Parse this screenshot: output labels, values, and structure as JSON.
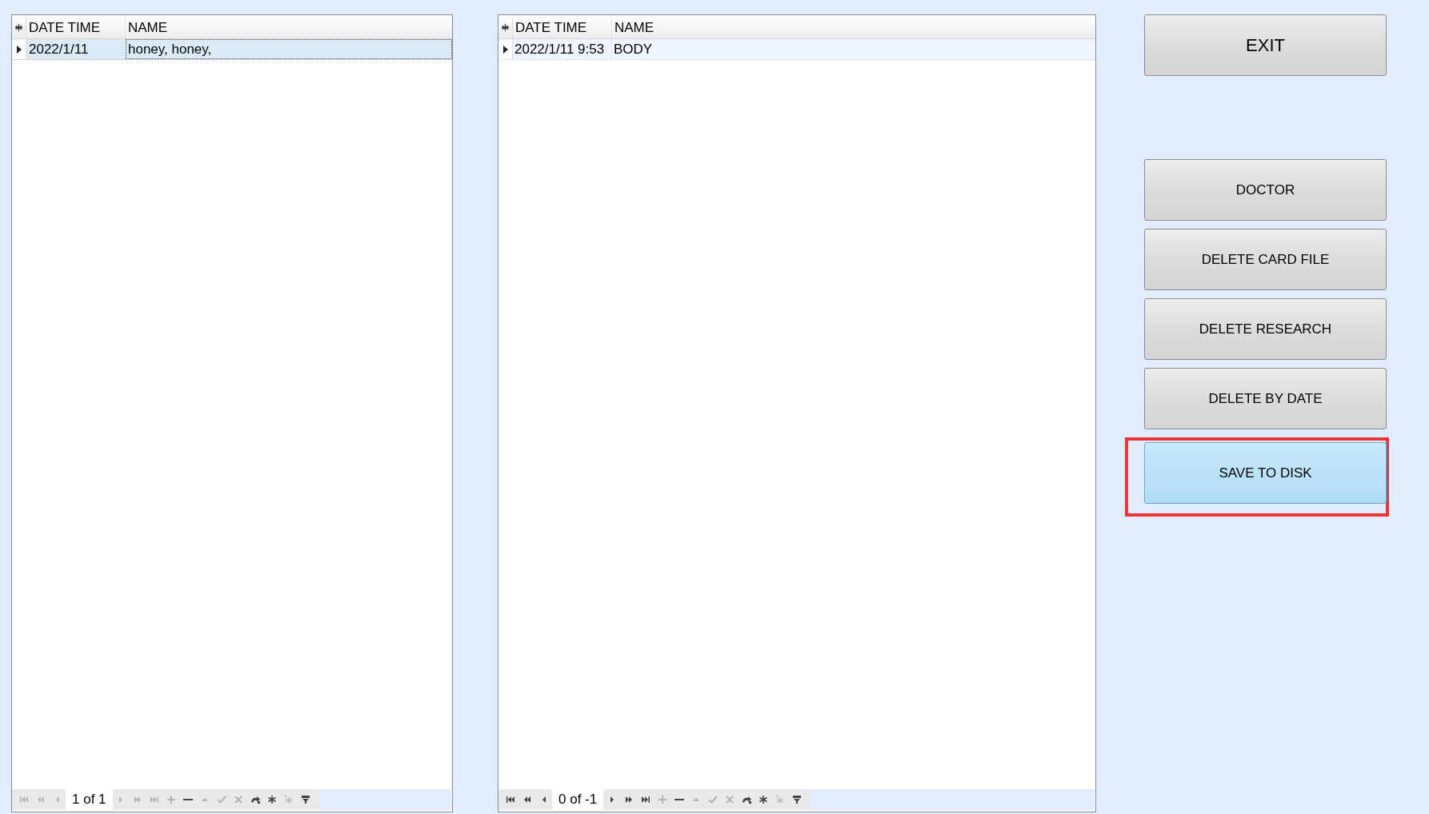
{
  "grids": [
    {
      "columns": [
        "DATE TIME",
        "NAME"
      ],
      "rows": [
        {
          "cells": [
            "2022/1/11",
            "honey, honey,"
          ],
          "selected": true
        }
      ],
      "navigator": {
        "position": "1 of 1",
        "buttons": [
          {
            "kind": "first",
            "disabled": true
          },
          {
            "kind": "prev_page",
            "disabled": true
          },
          {
            "kind": "prev",
            "disabled": true
          },
          {
            "kind": "next",
            "disabled": true
          },
          {
            "kind": "next_page",
            "disabled": true
          },
          {
            "kind": "last",
            "disabled": true
          },
          {
            "kind": "add",
            "disabled": true
          },
          {
            "kind": "remove",
            "disabled": false
          },
          {
            "kind": "up",
            "disabled": true
          },
          {
            "kind": "apply",
            "disabled": true
          },
          {
            "kind": "cancel",
            "disabled": true
          },
          {
            "kind": "refresh",
            "disabled": false
          },
          {
            "kind": "star",
            "disabled": false
          },
          {
            "kind": "clear",
            "disabled": true
          },
          {
            "kind": "filter",
            "disabled": false
          }
        ]
      }
    },
    {
      "columns": [
        "DATE TIME",
        "NAME"
      ],
      "rows": [
        {
          "cells": [
            "2022/1/11 9:53",
            "BODY"
          ],
          "selected": false
        }
      ],
      "navigator": {
        "position": "0 of -1",
        "buttons": [
          {
            "kind": "first",
            "disabled": false
          },
          {
            "kind": "prev_page",
            "disabled": false
          },
          {
            "kind": "prev",
            "disabled": false
          },
          {
            "kind": "next",
            "disabled": false
          },
          {
            "kind": "next_page",
            "disabled": false
          },
          {
            "kind": "last",
            "disabled": false
          },
          {
            "kind": "add",
            "disabled": true
          },
          {
            "kind": "remove",
            "disabled": false
          },
          {
            "kind": "up",
            "disabled": true
          },
          {
            "kind": "apply",
            "disabled": true
          },
          {
            "kind": "cancel",
            "disabled": true
          },
          {
            "kind": "refresh",
            "disabled": false
          },
          {
            "kind": "star",
            "disabled": false
          },
          {
            "kind": "clear",
            "disabled": true
          },
          {
            "kind": "filter",
            "disabled": false
          }
        ]
      }
    }
  ],
  "buttons": [
    {
      "label": "EXIT",
      "kind": "large",
      "hovered": false,
      "highlighted": false
    },
    {
      "label": "DOCTOR",
      "kind": "normal",
      "hovered": false,
      "highlighted": false
    },
    {
      "label": "DELETE CARD FILE",
      "kind": "normal",
      "hovered": false,
      "highlighted": false
    },
    {
      "label": "DELETE RESEARCH",
      "kind": "normal",
      "hovered": false,
      "highlighted": false
    },
    {
      "label": "DELETE BY DATE",
      "kind": "normal",
      "hovered": false,
      "highlighted": false
    },
    {
      "label": "SAVE TO DISK",
      "kind": "normal",
      "hovered": true,
      "highlighted": true
    }
  ]
}
